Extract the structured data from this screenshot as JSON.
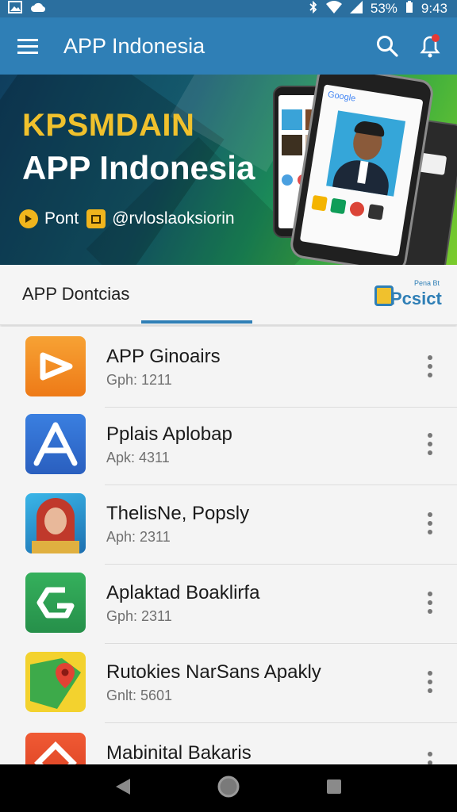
{
  "status": {
    "battery": "53%",
    "time": "9:43"
  },
  "app_bar": {
    "title": "APP Indonesia"
  },
  "hero": {
    "kicker": "KPSMDAIN",
    "title": "APP Indonesia",
    "meta_left": "Pont",
    "meta_right": "@rvloslaoksiorin",
    "phone_screen_label": "Google"
  },
  "tabs": {
    "active_label": "APP Dontcias",
    "logo_small": "Pena Bt",
    "logo_big": "Pcsict"
  },
  "apps": [
    {
      "name": "APP Ginoairs",
      "meta": "Gph: 1211",
      "icon": "play-icon",
      "color": "#f28a1f"
    },
    {
      "name": "Pplais Aplobap",
      "meta": "Apk: 4311",
      "icon": "a-letter-icon",
      "color": "#2f6fcf"
    },
    {
      "name": "ThelisNe, Popsly",
      "meta": "Aph: 2311",
      "icon": "portrait-icon",
      "color": "#3aa3d8"
    },
    {
      "name": "Aplaktad Boaklirfa",
      "meta": "Gph: 2311",
      "icon": "g-shape-icon",
      "color": "#2ea351"
    },
    {
      "name": "Rutokies NarSans Apakly",
      "meta": "Gnlt: 5601",
      "icon": "map-pin-icon",
      "color": "#f2d22e"
    },
    {
      "name": "Mabinital Bakaris",
      "meta": "",
      "icon": "diamond-icon",
      "color": "#ea4b2a"
    }
  ],
  "colors": {
    "app_bar": "#2f7fb6",
    "accent": "#f0c12d",
    "indicator": "#2f7fb6"
  }
}
